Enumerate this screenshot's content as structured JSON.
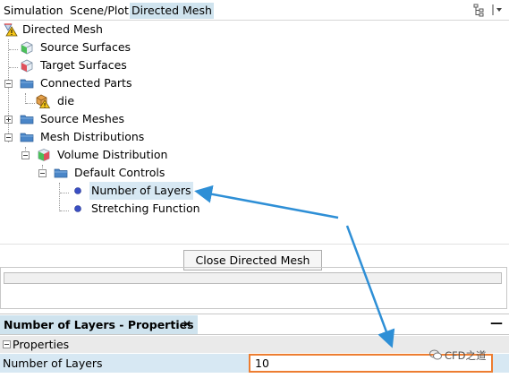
{
  "tabs": [
    {
      "label": "Simulation",
      "active": false
    },
    {
      "label": "Scene/Plot",
      "active": false
    },
    {
      "label": "Directed Mesh",
      "active": true
    }
  ],
  "tree": {
    "root": "Directed Mesh",
    "source_surfaces": "Source Surfaces",
    "target_surfaces": "Target Surfaces",
    "connected_parts": "Connected Parts",
    "die": "die",
    "source_meshes": "Source Meshes",
    "mesh_distributions": "Mesh Distributions",
    "volume_distribution": "Volume Distribution",
    "default_controls": "Default Controls",
    "number_of_layers": "Number of Layers",
    "stretching_function": "Stretching Function"
  },
  "close_button": "Close Directed Mesh",
  "properties": {
    "panel_title": "Number of Layers - Properties",
    "close_glyph": "✕",
    "minimize_glyph": "—",
    "section": "Properties",
    "row_label": "Number of Layers",
    "row_value": "10"
  },
  "watermark": "CFD之道",
  "colors": {
    "selection": "#d7e8f3",
    "active_tab": "#cfe3ee",
    "arrow": "#2e8fd6",
    "highlight_box": "#ed7d31"
  }
}
